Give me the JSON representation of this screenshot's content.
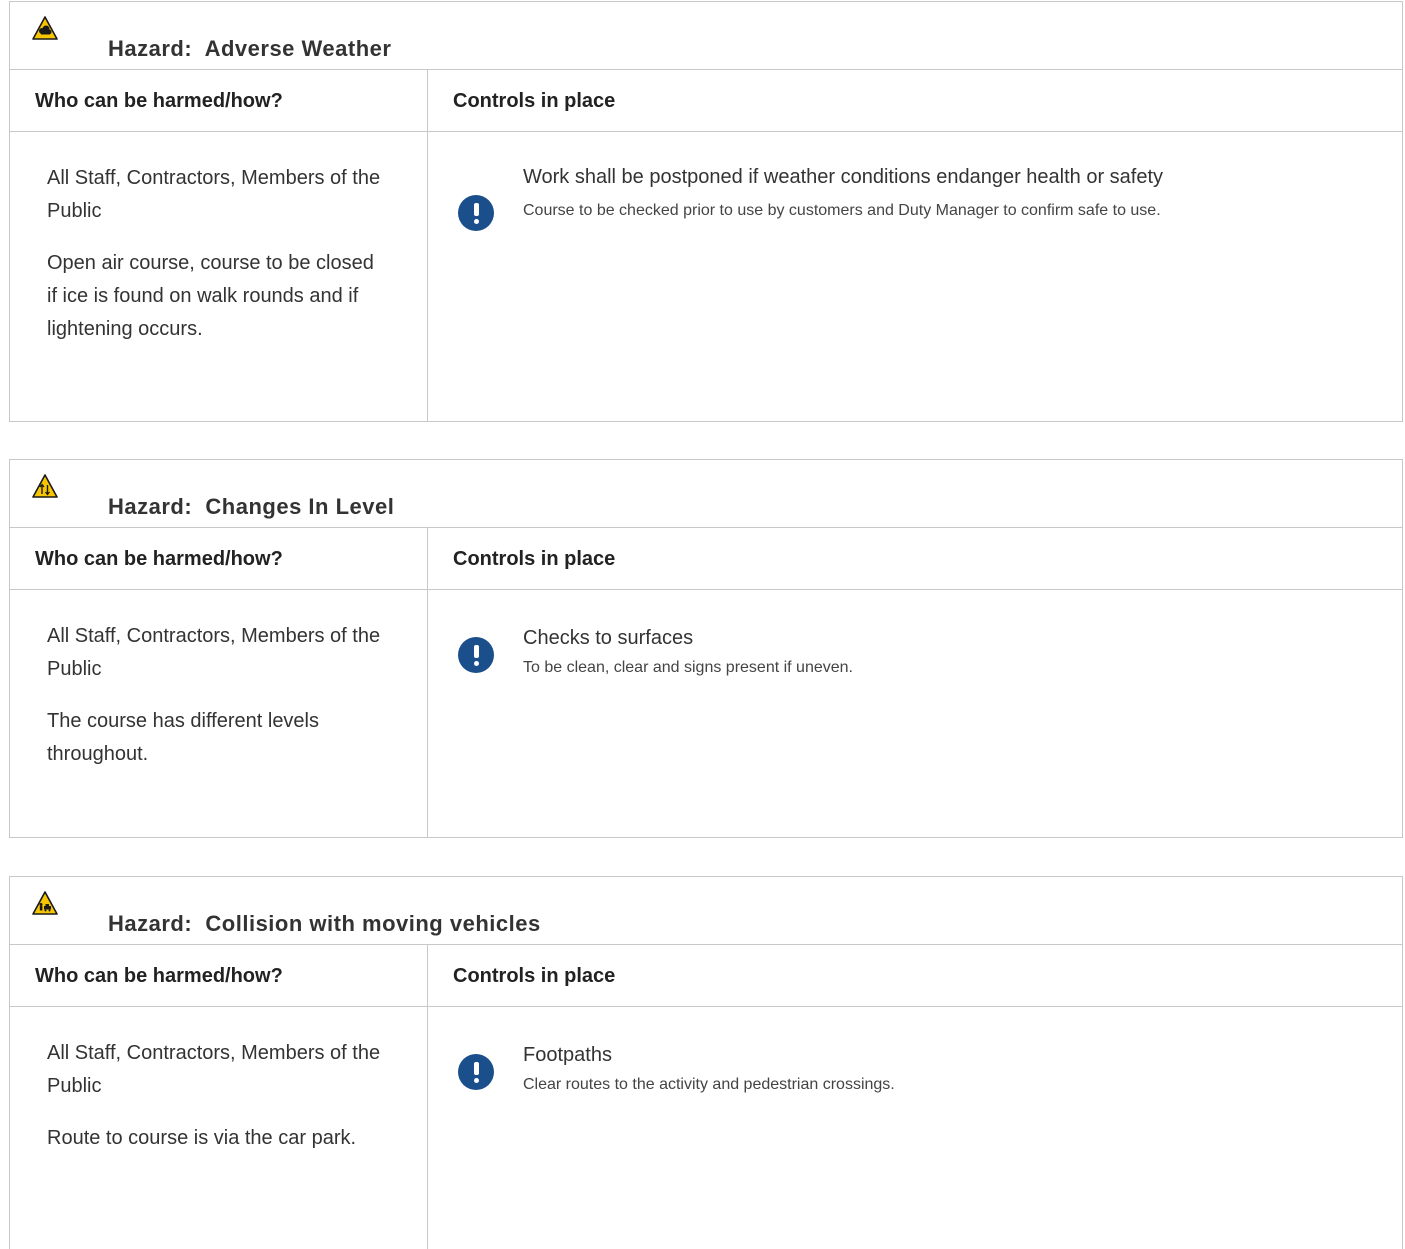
{
  "columns": {
    "who": "Who can be harmed/how?",
    "controls": "Controls in place"
  },
  "hazards": [
    {
      "title": "Hazard:  Adverse Weather",
      "icon": "warning-weather-icon",
      "who_line1": "All Staff, Contractors, Members of the Public",
      "who_line2": "Open air course, course to be closed if ice is found on walk rounds and if lightening occurs.",
      "control_title": "Work shall be postponed if weather conditions endanger health or safety",
      "control_desc": "Course to be checked prior to use by customers and Duty Manager to confirm safe to use."
    },
    {
      "title": "Hazard:  Changes In Level",
      "icon": "warning-level-change-icon",
      "who_line1": "All Staff, Contractors, Members of the Public",
      "who_line2": "The course has different levels throughout.",
      "control_title": "Checks to surfaces",
      "control_desc": "To be clean, clear and signs present if uneven."
    },
    {
      "title": "Hazard:  Collision with moving vehicles",
      "icon": "warning-vehicle-icon",
      "who_line1": "All Staff, Contractors, Members of the Public",
      "who_line2": "Route to course is via the car park.",
      "control_title": "Footpaths",
      "control_desc": "Clear routes to the activity and pedestrian crossings."
    }
  ],
  "colors": {
    "warning_yellow": "#f7c600",
    "control_icon_blue": "#1a4f8b",
    "border": "#c8c8c8"
  }
}
